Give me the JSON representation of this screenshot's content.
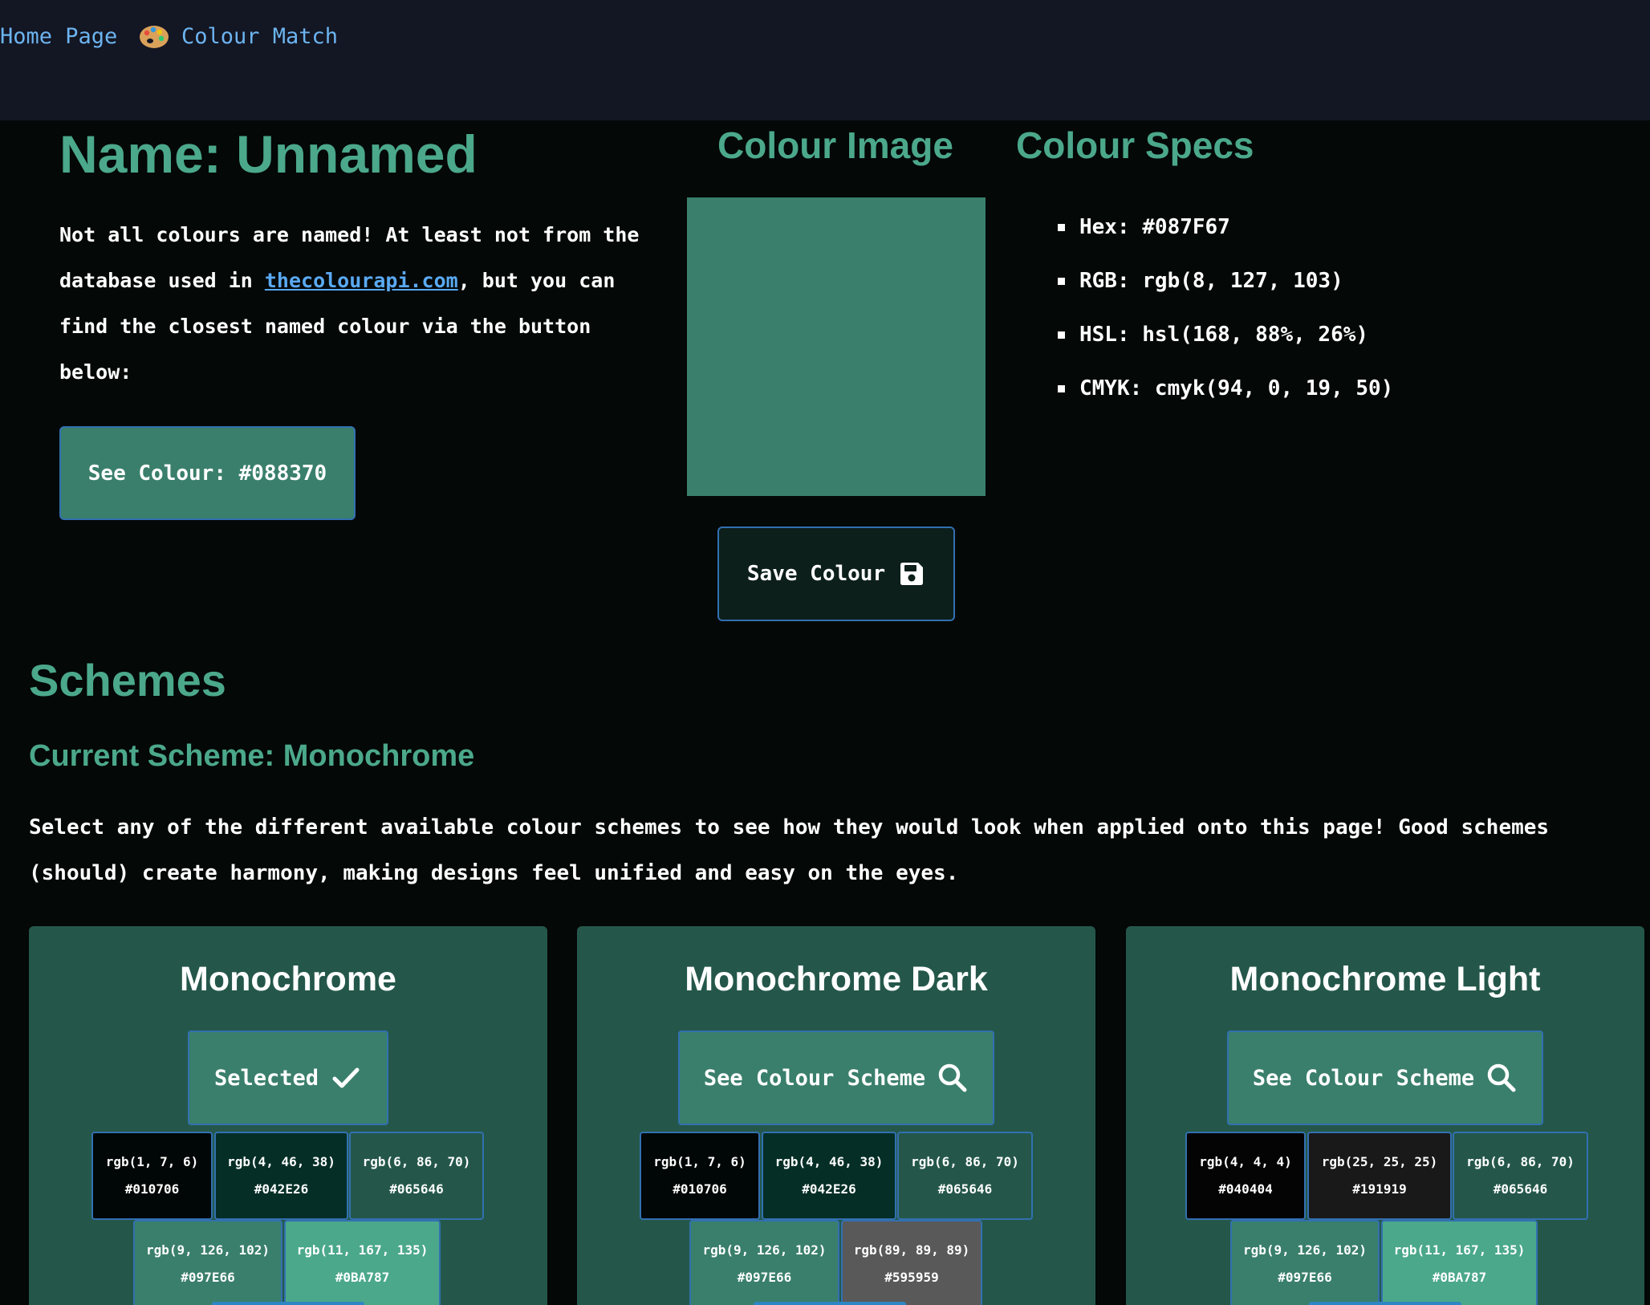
{
  "nav": {
    "home": "Home Page",
    "match": "Colour Match"
  },
  "colour": {
    "name_heading": "Name: Unnamed",
    "intro_before_link": "Not all colours are named! At least not from the database used in ",
    "intro_link": "thecolourapi.com",
    "intro_after_link": ", but you can find the closest named colour via the button below:",
    "see_colour_label": "See Colour: #088370",
    "image_heading": "Colour Image",
    "swatch_color": "#3a7f6c",
    "save_label": "Save Colour",
    "specs_heading": "Colour Specs",
    "specs": [
      "Hex: #087F67",
      "RGB: rgb(8, 127, 103)",
      "HSL: hsl(168, 88%, 26%)",
      "CMYK: cmyk(94, 0, 19, 50)"
    ]
  },
  "schemes": {
    "heading": "Schemes",
    "current": "Current Scheme: Monochrome",
    "description": "Select any of the different available colour schemes to see how they would look when applied onto this page! Good schemes (should) create harmony, making designs feel unified and easy on the eyes.",
    "cards": [
      {
        "title": "Monochrome",
        "button_label": "Selected",
        "button_icon": "check-icon",
        "chips": [
          {
            "rgb": "rgb(1, 7, 6)",
            "hex": "#010706",
            "bg": "#010706"
          },
          {
            "rgb": "rgb(4, 46, 38)",
            "hex": "#042E26",
            "bg": "#042e26"
          },
          {
            "rgb": "rgb(6, 86, 70)",
            "hex": "#065646",
            "bg": "#24574a"
          },
          {
            "rgb": "rgb(9, 126, 102)",
            "hex": "#097E66",
            "bg": "#3a7f6c"
          },
          {
            "rgb": "rgb(11, 167, 135)",
            "hex": "#0BA787",
            "bg": "#4ba88a"
          }
        ]
      },
      {
        "title": "Monochrome Dark",
        "button_label": "See Colour Scheme",
        "button_icon": "search-icon",
        "chips": [
          {
            "rgb": "rgb(1, 7, 6)",
            "hex": "#010706",
            "bg": "#010706"
          },
          {
            "rgb": "rgb(4, 46, 38)",
            "hex": "#042E26",
            "bg": "#042e26"
          },
          {
            "rgb": "rgb(6, 86, 70)",
            "hex": "#065646",
            "bg": "#24574a"
          },
          {
            "rgb": "rgb(9, 126, 102)",
            "hex": "#097E66",
            "bg": "#3a7f6c"
          },
          {
            "rgb": "rgb(89, 89, 89)",
            "hex": "#595959",
            "bg": "#595959"
          }
        ]
      },
      {
        "title": "Monochrome Light",
        "button_label": "See Colour Scheme",
        "button_icon": "search-icon",
        "chips": [
          {
            "rgb": "rgb(4, 4, 4)",
            "hex": "#040404",
            "bg": "#040404"
          },
          {
            "rgb": "rgb(25, 25, 25)",
            "hex": "#191919",
            "bg": "#191919"
          },
          {
            "rgb": "rgb(6, 86, 70)",
            "hex": "#065646",
            "bg": "#24574a"
          },
          {
            "rgb": "rgb(9, 126, 102)",
            "hex": "#097E66",
            "bg": "#3a7f6c"
          },
          {
            "rgb": "rgb(11, 167, 135)",
            "hex": "#0BA787",
            "bg": "#4ba88a"
          }
        ]
      }
    ]
  },
  "colors": {
    "page_bg": "#040807",
    "nav_bg": "#131623",
    "accent": "#4ba88a",
    "button_bg": "#3a7f6c",
    "card_bg": "#24574a",
    "link": "#5aa9f3",
    "border": "#3270b0"
  }
}
